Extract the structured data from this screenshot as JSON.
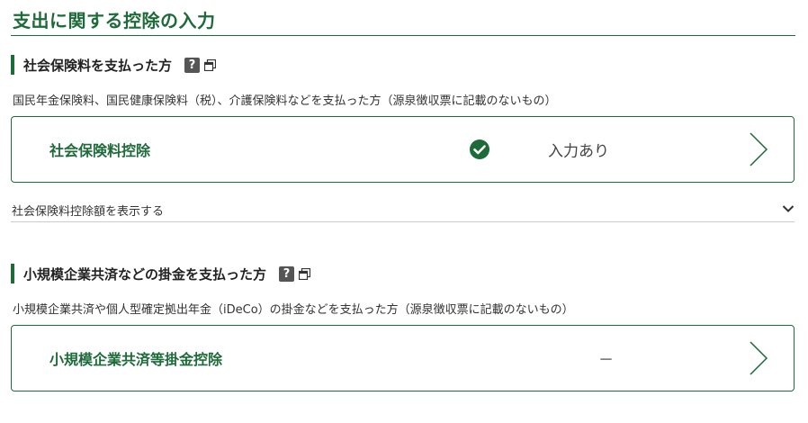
{
  "page": {
    "title": "支出に関する控除の入力"
  },
  "sections": [
    {
      "heading": "社会保険料を支払った方",
      "help": "?",
      "description": "国民年金保険料、国民健康保険料（税）、介護保険料などを支払った方（源泉徴収票に記載のないもの）",
      "card": {
        "title": "社会保険料控除",
        "status": "入力あり",
        "checked": true
      },
      "expander": {
        "label": "社会保険料控除額を表示する"
      }
    },
    {
      "heading": "小規模企業共済などの掛金を支払った方",
      "help": "?",
      "description": "小規模企業共済や個人型確定拠出年金（iDeCo）の掛金などを支払った方（源泉徴収票に記載のないもの）",
      "card": {
        "title": "小規模企業共済等掛金控除",
        "status": "－",
        "checked": false
      }
    }
  ],
  "colors": {
    "accent": "#1e6b3a",
    "text": "#333333"
  },
  "icons": [
    "check-circle-icon",
    "chevron-right-icon",
    "chevron-down-icon",
    "help-icon",
    "popout-icon"
  ]
}
